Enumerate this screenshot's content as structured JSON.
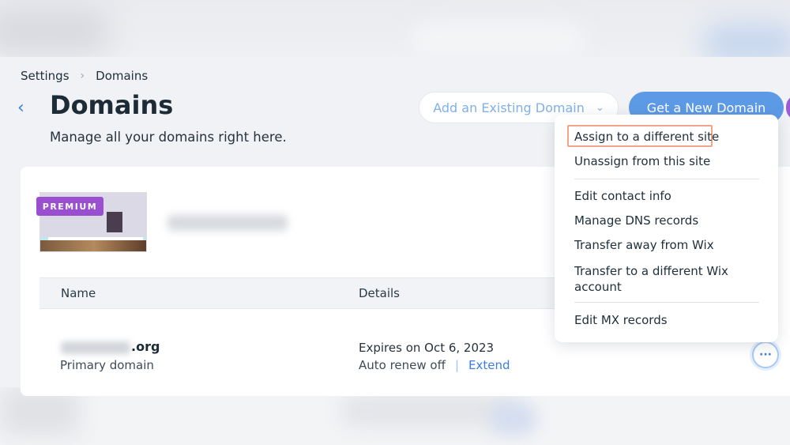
{
  "breadcrumb": {
    "root": "Settings",
    "current": "Domains"
  },
  "page": {
    "title": "Domains",
    "subtitle": "Manage all your domains right here."
  },
  "actions": {
    "add_existing": "Add an Existing Domain",
    "get_new": "Get a New Domain"
  },
  "site": {
    "badge": "PREMIUM"
  },
  "table": {
    "headers": [
      "Name",
      "Details"
    ],
    "rows": [
      {
        "domain_tld": ".org",
        "type": "Primary domain",
        "expires": "Expires on Oct 6, 2023",
        "renew": "Auto renew off",
        "divider": "|",
        "extend": "Extend"
      }
    ]
  },
  "more_button": {
    "icon": "more-horizontal-icon",
    "label": "···"
  },
  "menu": {
    "items": [
      "Assign to a different site",
      "Unassign from this site",
      "Edit contact info",
      "Manage DNS records",
      "Transfer away from Wix",
      "Transfer to a different Wix account",
      "Edit MX records"
    ],
    "highlighted_index": 0
  },
  "icons": {
    "breadcrumb_separator": "chevron-right-icon",
    "back": "chevron-left-icon",
    "dropdown": "chevron-down-icon"
  },
  "colors": {
    "accent": "#3b7de0",
    "primary_button": "#5d9ae6",
    "premium_badge": "#9a4fd0",
    "highlight_outline": "#f0a48a"
  }
}
